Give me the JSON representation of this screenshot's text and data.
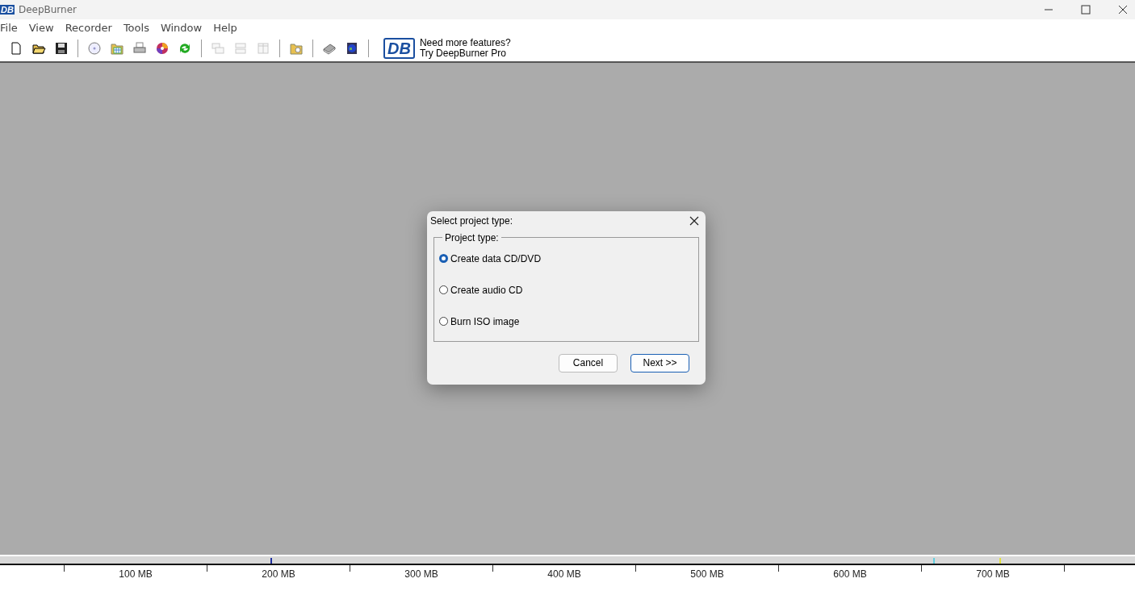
{
  "window": {
    "logo": "DB",
    "title": "DeepBurner"
  },
  "menu": [
    "File",
    "View",
    "Recorder",
    "Tools",
    "Window",
    "Help"
  ],
  "toolbar": [
    {
      "kind": "new",
      "disabled": false
    },
    {
      "kind": "open",
      "disabled": false
    },
    {
      "kind": "save",
      "disabled": false
    },
    {
      "kind": "sep"
    },
    {
      "kind": "disc",
      "disabled": false
    },
    {
      "kind": "grid",
      "disabled": false
    },
    {
      "kind": "printer",
      "disabled": false
    },
    {
      "kind": "colordisc",
      "disabled": false
    },
    {
      "kind": "refresh",
      "disabled": false
    },
    {
      "kind": "sep"
    },
    {
      "kind": "cascade",
      "disabled": true
    },
    {
      "kind": "tileh",
      "disabled": true
    },
    {
      "kind": "tilev",
      "disabled": true
    },
    {
      "kind": "sep"
    },
    {
      "kind": "folder",
      "disabled": false
    },
    {
      "kind": "sep"
    },
    {
      "kind": "book",
      "disabled": false
    },
    {
      "kind": "globe",
      "disabled": false
    },
    {
      "kind": "sep"
    }
  ],
  "promo": {
    "logo": "DB",
    "lines": [
      "Need more features?",
      "Try DeepBurner Pro"
    ]
  },
  "dialog": {
    "title": "Select project type:",
    "group": "Project type:",
    "options": [
      {
        "label": "Create data CD/DVD",
        "selected": true
      },
      {
        "label": "Create audio CD",
        "selected": false
      },
      {
        "label": "Burn ISO image",
        "selected": false
      }
    ],
    "buttons": [
      "Cancel",
      "Next >>"
    ]
  },
  "ruler": {
    "labels": [
      "100 MB",
      "200 MB",
      "300 MB",
      "400 MB",
      "500 MB",
      "600 MB",
      "700 MB"
    ]
  }
}
